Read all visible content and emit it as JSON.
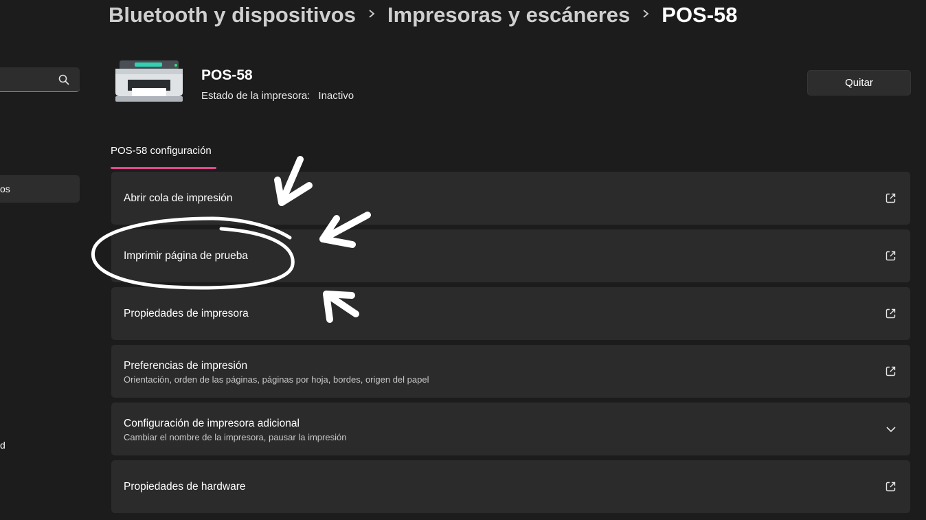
{
  "breadcrumb": {
    "items": [
      "Bluetooth y dispositivos",
      "Impresoras y escáneres",
      "POS-58"
    ]
  },
  "sidebar": {
    "selected_fragment": "os",
    "lower_fragment": "d"
  },
  "device": {
    "name": "POS-58",
    "status_label": "Estado de la impresora:",
    "status_value": "Inactivo",
    "remove_label": "Quitar"
  },
  "tab": {
    "label": "POS-58 configuración"
  },
  "settings": {
    "items": [
      {
        "title": "Abrir cola de impresión",
        "icon": "open-external-icon"
      },
      {
        "title": "Imprimir página de prueba",
        "icon": "open-external-icon"
      },
      {
        "title": "Propiedades de impresora",
        "icon": "open-external-icon"
      },
      {
        "title": "Preferencias de impresión",
        "subtitle": "Orientación, orden de las páginas, páginas por hoja, bordes, origen del papel",
        "icon": "open-external-icon"
      },
      {
        "title": "Configuración de impresora adicional",
        "subtitle": "Cambiar el nombre de la impresora, pausar la impresión",
        "icon": "chevron-down-icon"
      },
      {
        "title": "Propiedades de hardware",
        "icon": "open-external-icon"
      }
    ]
  },
  "colors": {
    "background": "#1c1c1c",
    "card": "#2b2b2b",
    "accent": "#e3468f",
    "annotation": "#ffffff"
  }
}
